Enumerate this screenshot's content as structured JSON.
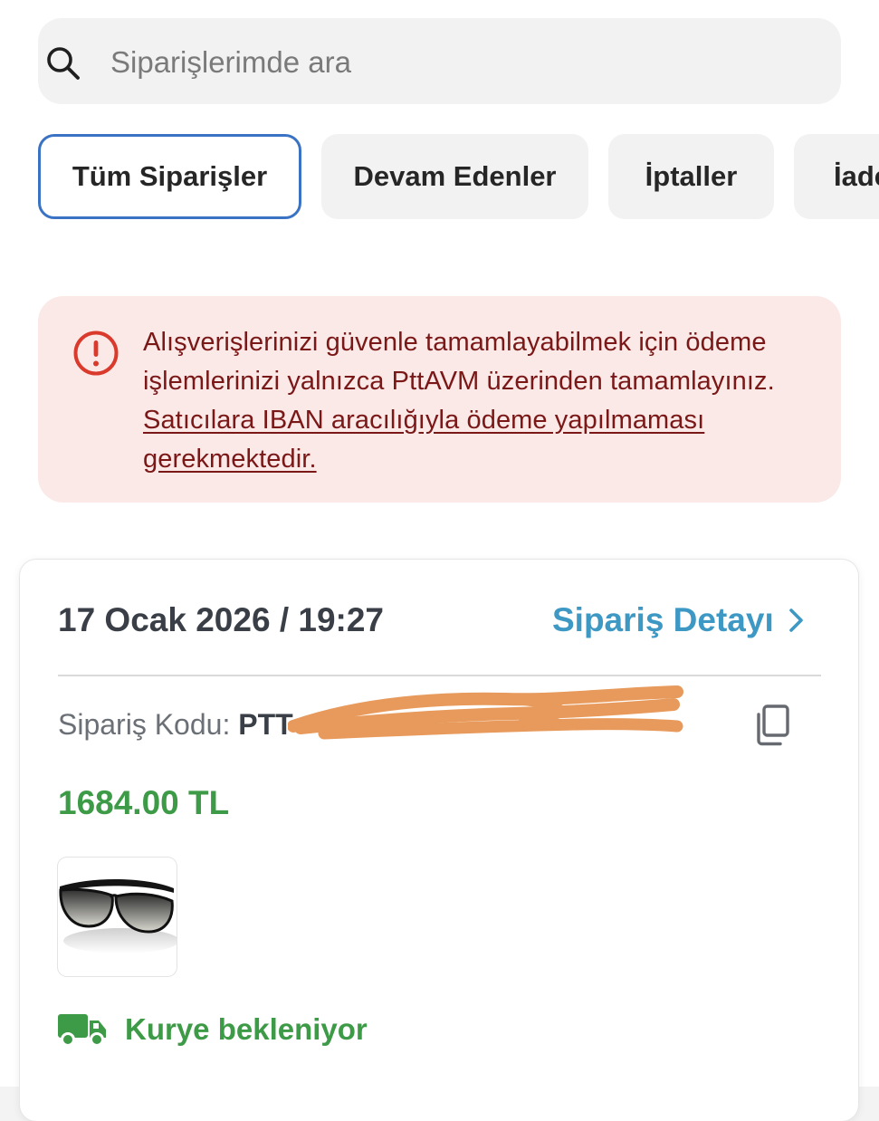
{
  "search": {
    "placeholder": "Siparişlerimde ara",
    "icon": "search-icon"
  },
  "tabs": [
    {
      "label": "Tüm Siparişler",
      "active": true
    },
    {
      "label": "Devam Edenler",
      "active": false
    },
    {
      "label": "İptaller",
      "active": false
    },
    {
      "label": "İade",
      "active": false
    }
  ],
  "alert": {
    "icon": "alert-circle-icon",
    "text": "Alışverişlerinizi güvenle tamamlayabilmek için ödeme işlemlerinizi yalnızca PttAVM üzerinden tamamlayınız. ",
    "link_text": "Satıcılara IBAN aracılığıyla ödeme yapılmaması gerekmektedir.",
    "colors": {
      "background": "#fbe9e8",
      "text": "#7a1717",
      "icon": "#d93a2b"
    }
  },
  "order": {
    "date": "17 Ocak 2026 / 19:27",
    "detail_link": "Sipariş Detayı",
    "code_label": "Sipariş Kodu:",
    "code_value": "PTT",
    "price": "1684.00 TL",
    "status": "Kurye bekleniyor",
    "product_image": "sunglasses",
    "colors": {
      "link": "#3e98c4",
      "price": "#3d9a46",
      "status": "#3d9a46"
    }
  },
  "colors": {
    "tab_active_border": "#3a73c4",
    "redaction": "#e79a5b"
  }
}
